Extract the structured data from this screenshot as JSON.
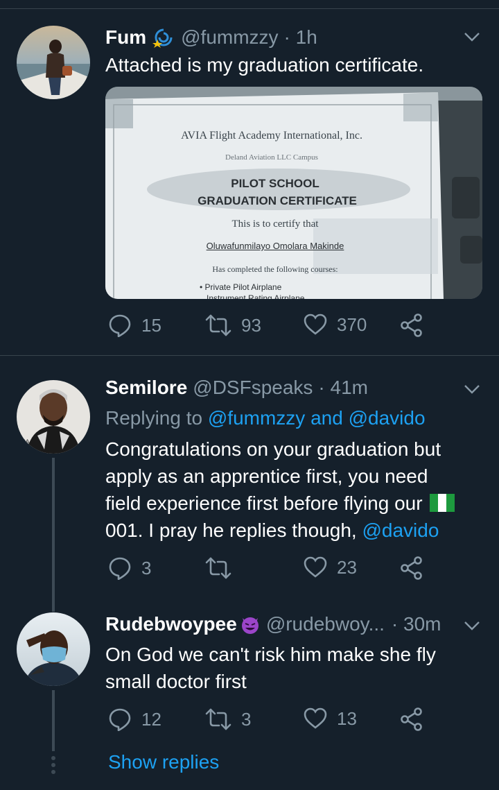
{
  "tweets": [
    {
      "name": "Fum",
      "handle": "@fummzzy",
      "time": "· 1h",
      "text": "Attached is my graduation certificate.",
      "replies": "15",
      "retweets": "93",
      "likes": "370",
      "certificate": {
        "academy": "AVIA Flight Academy International, Inc.",
        "campus": "Deland Aviation LLC Campus",
        "title1": "PILOT SCHOOL",
        "title2": "GRADUATION CERTIFICATE",
        "certify": "This is to certify that",
        "recipient": "Oluwafunmilayo Omolara Makinde",
        "completed": "Has completed the following courses:",
        "course1": "• Private Pilot Airplane",
        "course2": "Instrument Rating Airplane"
      }
    },
    {
      "name": "Semilore",
      "handle": "@DSFspeaks",
      "time": "· 41m",
      "replying_prefix": "Replying to ",
      "replying_user1": "@fummzzy",
      "replying_and": " and ",
      "replying_user2": "@davido",
      "lines": [
        "Congratulations on your graduation but",
        "apply as an apprentice first, you need",
        "field experience first before flying our",
        "001.  I pray he replies  though, "
      ],
      "mention": "@davido",
      "replies": "3",
      "retweets": "",
      "likes": "23"
    },
    {
      "name": "Rudebwoypee",
      "handle": "@rudebwoy...",
      "time": "· 30m",
      "lines": [
        "On God we can't risk him make she fly",
        "small doctor first"
      ],
      "replies": "12",
      "retweets": "3",
      "likes": "13"
    }
  ],
  "show_replies": "Show replies",
  "colors": {
    "background": "#15202b",
    "secondary": "#8899a6",
    "link": "#1da1f2",
    "divider": "#38444d"
  }
}
